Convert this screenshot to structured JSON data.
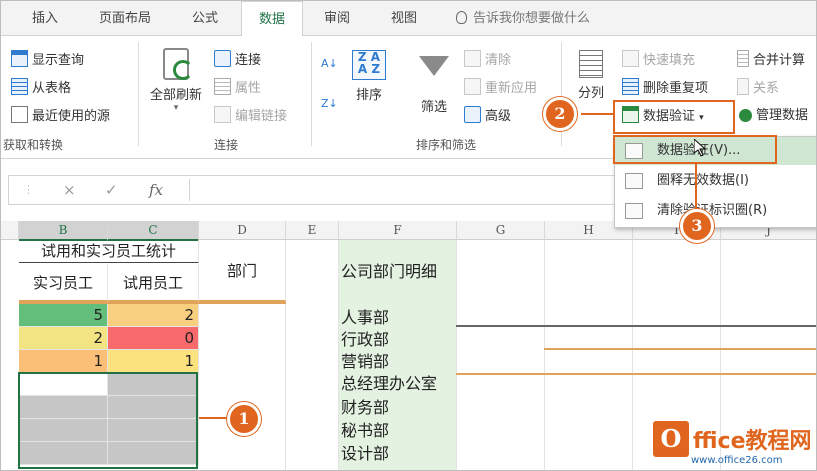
{
  "tabs": [
    {
      "label": "插入",
      "active": false
    },
    {
      "label": "页面布局",
      "active": false
    },
    {
      "label": "公式",
      "active": false
    },
    {
      "label": "数据",
      "active": true
    },
    {
      "label": "审阅",
      "active": false
    },
    {
      "label": "视图",
      "active": false
    }
  ],
  "tell_me": "告诉我你想要做什么",
  "ribbon": {
    "get_transform": {
      "items": [
        "显示查询",
        "从表格",
        "最近使用的源"
      ],
      "group_label": "获取和转换"
    },
    "connections": {
      "refresh_all": "全部刷新",
      "items": [
        "连接",
        "属性",
        "编辑链接"
      ],
      "group_label": "连接"
    },
    "sort_filter": {
      "sort": "排序",
      "filter": "筛选",
      "clear": "清除",
      "reapply": "重新应用",
      "advanced": "高级",
      "group_label": "排序和筛选"
    },
    "data_tools": {
      "split": "分列",
      "flash_fill": "快速填充",
      "remove_dup": "删除重复项",
      "validation": "数据验证",
      "consolidate": "合并计算",
      "relations": "关系",
      "manage_model": "管理数据"
    }
  },
  "dropdown": {
    "items": [
      "数据验证(V)...",
      "圈释无效数据(I)",
      "清除验证标识圈(R)"
    ]
  },
  "formula_bar": {
    "cancel": "×",
    "enter": "✓",
    "fx": "fx"
  },
  "columns": [
    "B",
    "C",
    "D",
    "E",
    "F",
    "G",
    "H",
    "I",
    "J"
  ],
  "table": {
    "title": "试用和实习员工统计",
    "col1": "实习员工",
    "col2": "试用员工",
    "rows": [
      {
        "a": "5",
        "b": "2",
        "a_color": "#63be7b",
        "b_color": "#f8cf7e"
      },
      {
        "a": "2",
        "b": "0",
        "a_color": "#f2e383",
        "b_color": "#f8696b"
      },
      {
        "a": "1",
        "b": "1",
        "a_color": "#fbbf78",
        "b_color": "#fbe27f"
      }
    ]
  },
  "dept_header": "部门",
  "dept_detail_header": "公司部门明细",
  "departments": [
    "人事部",
    "行政部",
    "营销部",
    "总经理办公室",
    "财务部",
    "秘书部",
    "设计部"
  ],
  "annotations": [
    "1",
    "2",
    "3"
  ],
  "watermark": {
    "logo": "O",
    "text": "ffice教程网",
    "url": "www.office26.com"
  }
}
